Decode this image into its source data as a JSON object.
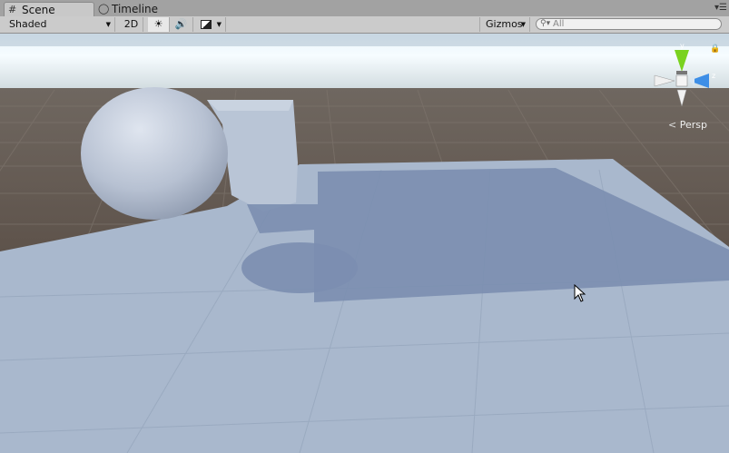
{
  "tabs": [
    {
      "label": "Scene",
      "icon": "scene-grid-icon",
      "active": true
    },
    {
      "label": "Timeline",
      "icon": "timeline-icon",
      "active": false
    }
  ],
  "toolbar": {
    "draw_mode": "Shaded",
    "mode_2d": "2D",
    "gizmos": "Gizmos",
    "search_placeholder": "All"
  },
  "gizmo": {
    "projection": "Persp",
    "axis_y": "y",
    "axis_z": "z"
  },
  "colors": {
    "sky": "#f4fbff",
    "ground": "#6b6058",
    "plane": "#a8b7cc",
    "shadow": "#7a8db0",
    "axis_y": "#7ad21f",
    "axis_z": "#3d8ee6"
  }
}
